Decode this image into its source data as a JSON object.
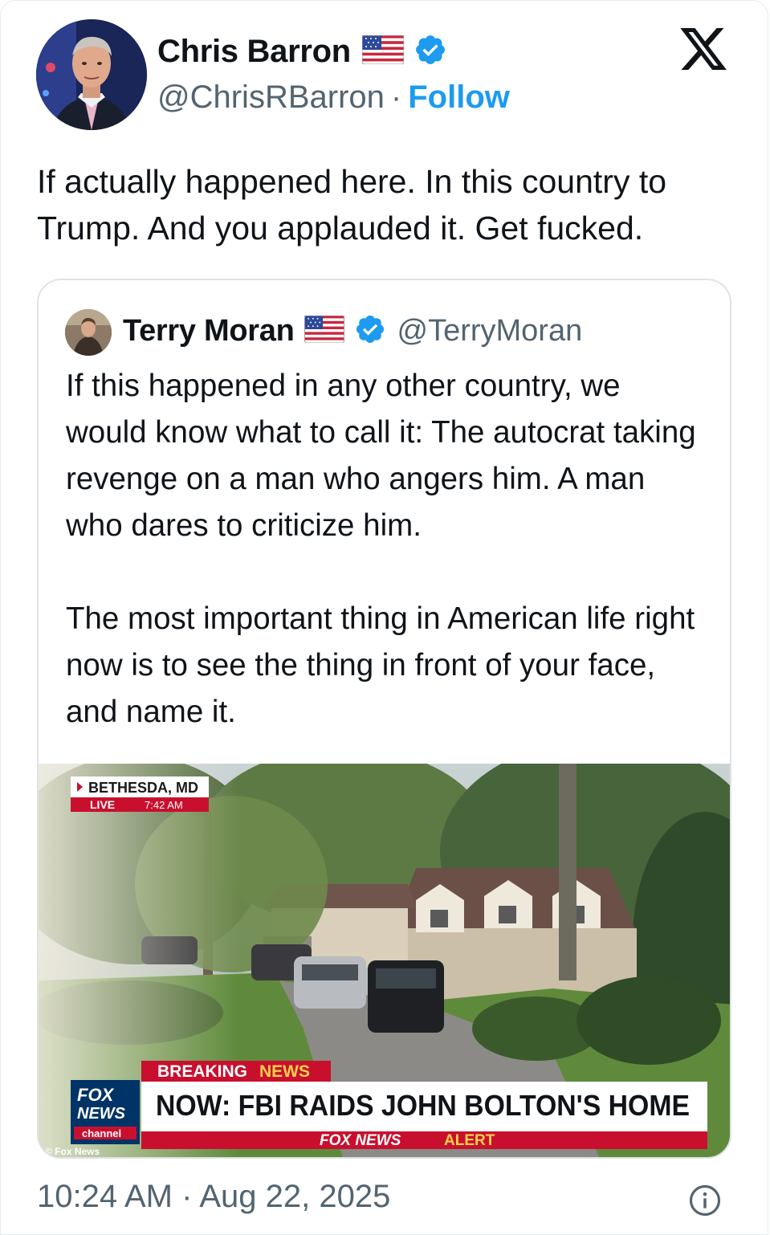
{
  "author": {
    "name": "Chris Barron",
    "handle": "@ChrisRBarron",
    "separator": "·",
    "follow_label": "Follow"
  },
  "tweet": {
    "text": "If actually happened here. In this country to Trump. And you applauded it. Get fucked."
  },
  "quoted": {
    "name": "Terry Moran",
    "handle": "@TerryMoran",
    "paragraph1": "If this happened in any other country, we would know what to call it: The autocrat taking revenge on a man who angers him. A man who dares to criticize him.",
    "paragraph2": "The most important thing in American life right now is to see the thing in front of your face, and name it.",
    "media": {
      "location": "BETHESDA, MD",
      "live_label": "LIVE",
      "live_time": "7:42 AM",
      "breaking_label": "BREAKING",
      "breaking_label_accent": "NEWS",
      "headline": "NOW: FBI RAIDS JOHN BOLTON'S HOME",
      "alert_label": "FOX NEWS",
      "alert_label_accent": "ALERT",
      "logo_line1": "FOX",
      "logo_line2": "NEWS",
      "logo_line3": "channel",
      "credit": "© Fox News"
    }
  },
  "footer": {
    "timestamp": "10:24 AM · Aug 22, 2025"
  },
  "icons": [
    "us-flag-icon",
    "verified-badge-icon",
    "x-logo-icon",
    "info-icon"
  ],
  "colors": {
    "accent": "#1d9bf0",
    "secondary_text": "#536471",
    "fox_red": "#c8102e",
    "fox_blue": "#003366"
  }
}
